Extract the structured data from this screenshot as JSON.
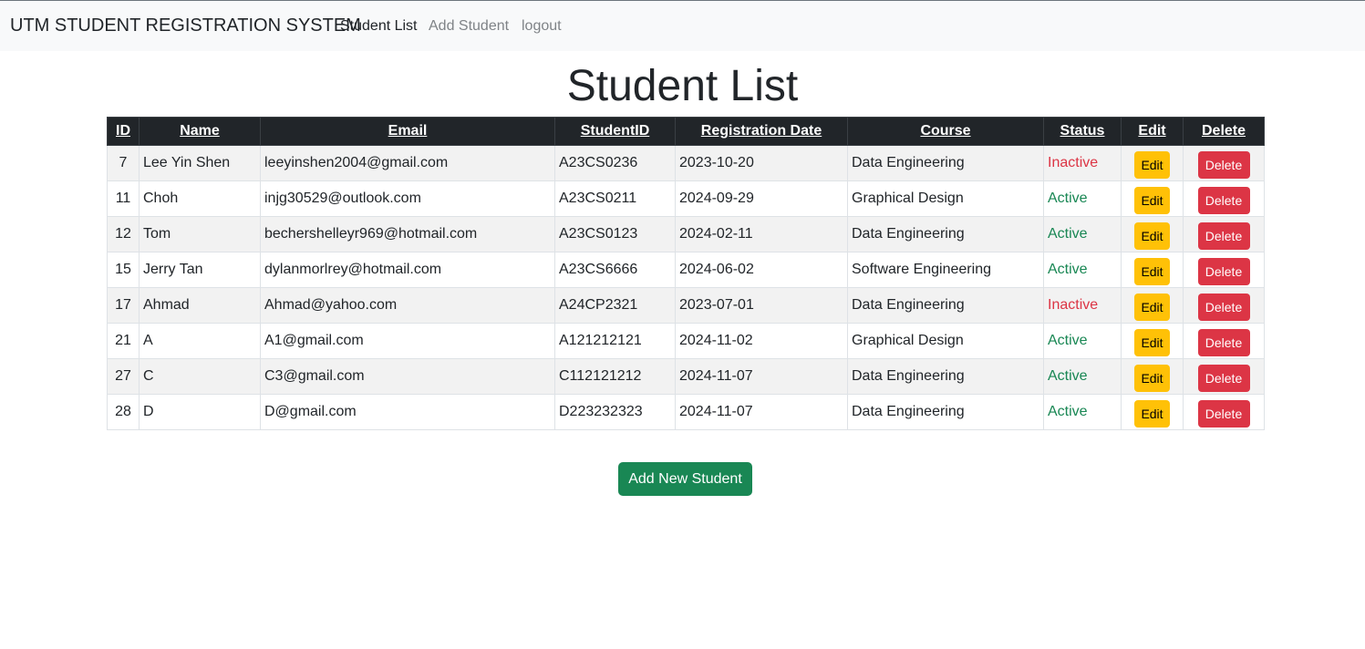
{
  "nav": {
    "brand": "UTM STUDENT REGISTRATION SYSTEM",
    "links": [
      "Student List",
      "Add Student",
      "logout"
    ]
  },
  "page_title": "Student List",
  "table": {
    "headers": [
      "ID",
      "Name",
      "Email",
      "StudentID",
      "Registration Date",
      "Course",
      "Status",
      "Edit",
      "Delete"
    ],
    "rows": [
      {
        "id": "7",
        "name": "Lee Yin Shen",
        "email": "leeyinshen2004@gmail.com",
        "student_id": "A23CS0236",
        "date": "2023-10-20",
        "course": "Data Engineering",
        "status": "Inactive"
      },
      {
        "id": "11",
        "name": "Choh",
        "email": "injg30529@outlook.com",
        "student_id": "A23CS0211",
        "date": "2024-09-29",
        "course": "Graphical Design",
        "status": "Active"
      },
      {
        "id": "12",
        "name": "Tom",
        "email": "bechershelleyr969@hotmail.com",
        "student_id": "A23CS0123",
        "date": "2024-02-11",
        "course": "Data Engineering",
        "status": "Active"
      },
      {
        "id": "15",
        "name": "Jerry Tan",
        "email": "dylanmorlrey@hotmail.com",
        "student_id": "A23CS6666",
        "date": "2024-06-02",
        "course": "Software Engineering",
        "status": "Active"
      },
      {
        "id": "17",
        "name": "Ahmad",
        "email": "Ahmad@yahoo.com",
        "student_id": "A24CP2321",
        "date": "2023-07-01",
        "course": "Data Engineering",
        "status": "Inactive"
      },
      {
        "id": "21",
        "name": "A",
        "email": "A1@gmail.com",
        "student_id": "A121212121",
        "date": "2024-11-02",
        "course": "Graphical Design",
        "status": "Active"
      },
      {
        "id": "27",
        "name": "C",
        "email": "C3@gmail.com",
        "student_id": "C112121212",
        "date": "2024-11-07",
        "course": "Data Engineering",
        "status": "Active"
      },
      {
        "id": "28",
        "name": "D",
        "email": "D@gmail.com",
        "student_id": "D223232323",
        "date": "2024-11-07",
        "course": "Data Engineering",
        "status": "Active"
      }
    ],
    "edit_label": "Edit",
    "delete_label": "Delete"
  },
  "add_button_label": "Add New Student",
  "colors": {
    "navbar_bg": "#f8f9fa",
    "header_bg": "#212529",
    "active": "#198754",
    "inactive": "#dc3545",
    "edit_btn": "#ffc107",
    "delete_btn": "#dc3545",
    "add_btn": "#198754"
  }
}
